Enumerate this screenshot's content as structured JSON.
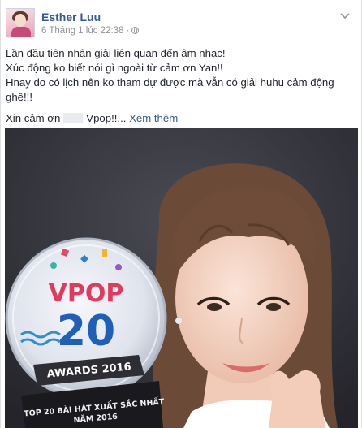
{
  "post": {
    "author": "Esther Luu",
    "timestamp": "6 Tháng 1 lúc 22:38",
    "separator": "·",
    "lines": [
      "Lần đầu tiên nhận giải liên quan đến âm nhạc!",
      "Xúc động ko biết nói gì ngoài từ cảm ơn Yan!!",
      "Hnay do có lịch nên ko tham dự được mà vẫn có giải huhu cảm động ghê!!!"
    ],
    "closing_before": "Xin cảm ơn",
    "closing_after": "Vpop!!...",
    "see_more": "Xem thêm"
  },
  "photo": {
    "trophy": {
      "vpop": "VPOP",
      "number": "20",
      "awards": "AWARDS 2016",
      "caption_line1": "TOP 20 BÀI HÁT XUẤT SẮC NHẤT",
      "caption_line2": "NĂM 2016"
    }
  },
  "icons": {
    "privacy": "globe-icon",
    "options": "chevron-down-icon"
  },
  "colors": {
    "link": "#365899",
    "text": "#1d2129",
    "meta": "#90949c",
    "background": "#ffffff"
  }
}
